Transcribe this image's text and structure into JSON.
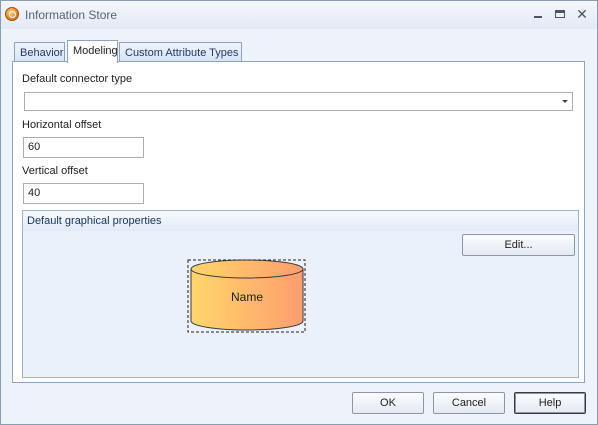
{
  "window": {
    "title": "Information Store",
    "controls": [
      "minimize",
      "maximize",
      "close"
    ]
  },
  "tabs": [
    {
      "label": "Behavior",
      "active": false
    },
    {
      "label": "Modeling",
      "active": true
    },
    {
      "label": "Custom Attribute Types",
      "active": false
    }
  ],
  "form": {
    "connector_label": "Default connector type",
    "connector_value": "",
    "hoffset_label": "Horizontal offset",
    "hoffset_value": "60",
    "voffset_label": "Vertical offset",
    "voffset_value": "40"
  },
  "graphics": {
    "title": "Default graphical properties",
    "edit_label": "Edit...",
    "shape_label": "Name",
    "shape_fill_start": "#ffd66b",
    "shape_fill_end": "#ff9d6e"
  },
  "buttons": {
    "ok": "OK",
    "cancel": "Cancel",
    "help": "Help"
  }
}
